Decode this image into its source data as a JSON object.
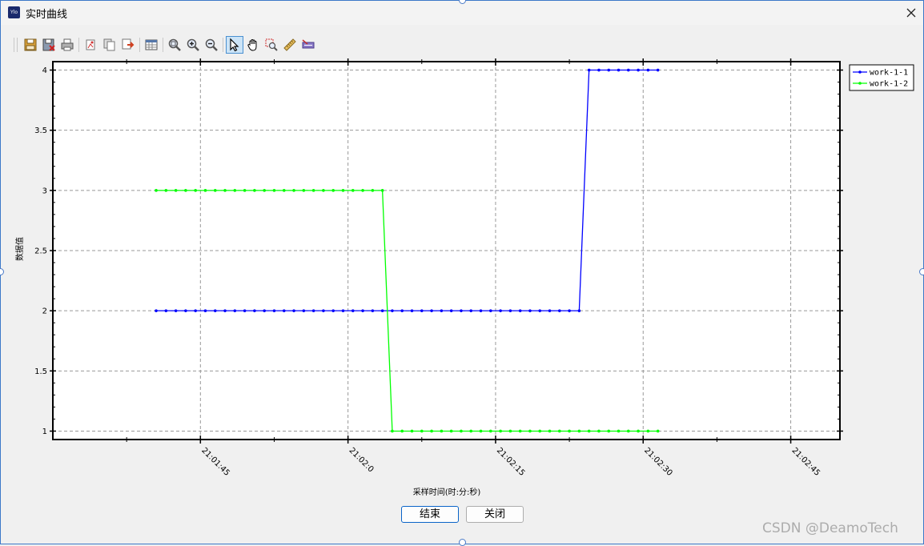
{
  "window": {
    "title": "实时曲线",
    "app_icon_text": "Ylo"
  },
  "toolbar": {
    "buttons": [
      {
        "name": "save-icon"
      },
      {
        "name": "save-as-icon"
      },
      {
        "name": "print-icon"
      },
      {
        "name": "copy-image-icon"
      },
      {
        "name": "copy-icon"
      },
      {
        "name": "export-icon"
      },
      {
        "name": "data-table-icon"
      },
      {
        "name": "zoom-fit-icon"
      },
      {
        "name": "zoom-in-icon"
      },
      {
        "name": "zoom-out-icon"
      },
      {
        "name": "select-pointer-icon",
        "active": true
      },
      {
        "name": "pan-hand-icon"
      },
      {
        "name": "zoom-box-icon"
      },
      {
        "name": "measure-ruler-icon"
      },
      {
        "name": "marker-icon"
      }
    ]
  },
  "chart_data": {
    "type": "line",
    "xlabel": "采样时间(时:分:秒)",
    "ylabel": "数据值",
    "xlim": [
      0,
      80
    ],
    "ylim": [
      0.93,
      4.07
    ],
    "x_ticks": [
      {
        "t": 15,
        "label": "21:01:45"
      },
      {
        "t": 30,
        "label": "21:02:0"
      },
      {
        "t": 45,
        "label": "21:02:15"
      },
      {
        "t": 60,
        "label": "21:02:30"
      },
      {
        "t": 75,
        "label": "21:02:45"
      }
    ],
    "y_ticks": [
      {
        "v": 1,
        "label": "1"
      },
      {
        "v": 1.5,
        "label": "1.5"
      },
      {
        "v": 2,
        "label": "2"
      },
      {
        "v": 2.5,
        "label": "2.5"
      },
      {
        "v": 3,
        "label": "3"
      },
      {
        "v": 3.5,
        "label": "3.5"
      },
      {
        "v": 4,
        "label": "4"
      }
    ],
    "grid": true,
    "legend": "top-right",
    "series": [
      {
        "name": "work-1-1",
        "color": "#0000ff",
        "x_start": 10.5,
        "x_step": 1,
        "values": [
          2,
          2,
          2,
          2,
          2,
          2,
          2,
          2,
          2,
          2,
          2,
          2,
          2,
          2,
          2,
          2,
          2,
          2,
          2,
          2,
          2,
          2,
          2,
          2,
          2,
          2,
          2,
          2,
          2,
          2,
          2,
          2,
          2,
          2,
          2,
          2,
          2,
          2,
          2,
          2,
          2,
          2,
          2,
          2,
          4,
          4,
          4,
          4,
          4,
          4,
          4,
          4
        ]
      },
      {
        "name": "work-1-2",
        "color": "#00ff00",
        "x_start": 10.5,
        "x_step": 1,
        "values": [
          3,
          3,
          3,
          3,
          3,
          3,
          3,
          3,
          3,
          3,
          3,
          3,
          3,
          3,
          3,
          3,
          3,
          3,
          3,
          3,
          3,
          3,
          3,
          3,
          1,
          1,
          1,
          1,
          1,
          1,
          1,
          1,
          1,
          1,
          1,
          1,
          1,
          1,
          1,
          1,
          1,
          1,
          1,
          1,
          1,
          1,
          1,
          1,
          1,
          1,
          1,
          1
        ]
      }
    ]
  },
  "buttons": {
    "end_label": "结束",
    "close_label": "关闭"
  },
  "watermark": "CSDN @DeamoTech"
}
